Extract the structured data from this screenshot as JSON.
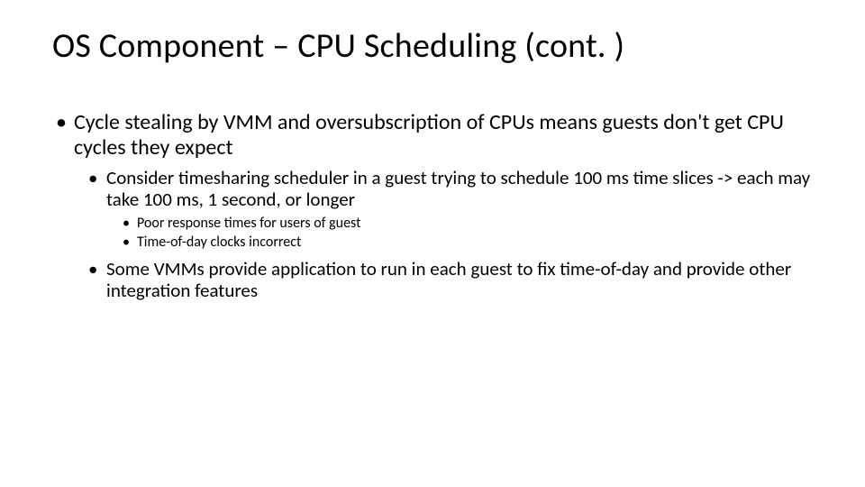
{
  "title": "OS Component – CPU Scheduling (cont. )",
  "bullets": {
    "l1_0": "Cycle stealing by VMM and oversubscription of CPUs means guests don't get CPU cycles they expect",
    "l2_0": "Consider timesharing scheduler in a guest trying to schedule 100 ms time slices -> each may take 100 ms, 1 second, or longer",
    "l3_0": "Poor response times for users of guest",
    "l3_1": "Time-of-day clocks incorrect",
    "l2_1": "Some VMMs provide application to run in each guest to fix time-of-day and provide other integration features"
  }
}
